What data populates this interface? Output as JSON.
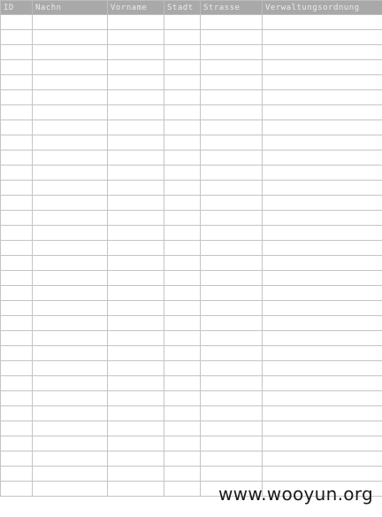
{
  "table": {
    "columns": [
      "ID",
      "Nachn",
      "Vorname",
      "Stadt",
      "Strasse",
      "Verwaltungsordnung"
    ],
    "row_count": 32
  },
  "watermark": {
    "text": "www.wooyun.org"
  }
}
